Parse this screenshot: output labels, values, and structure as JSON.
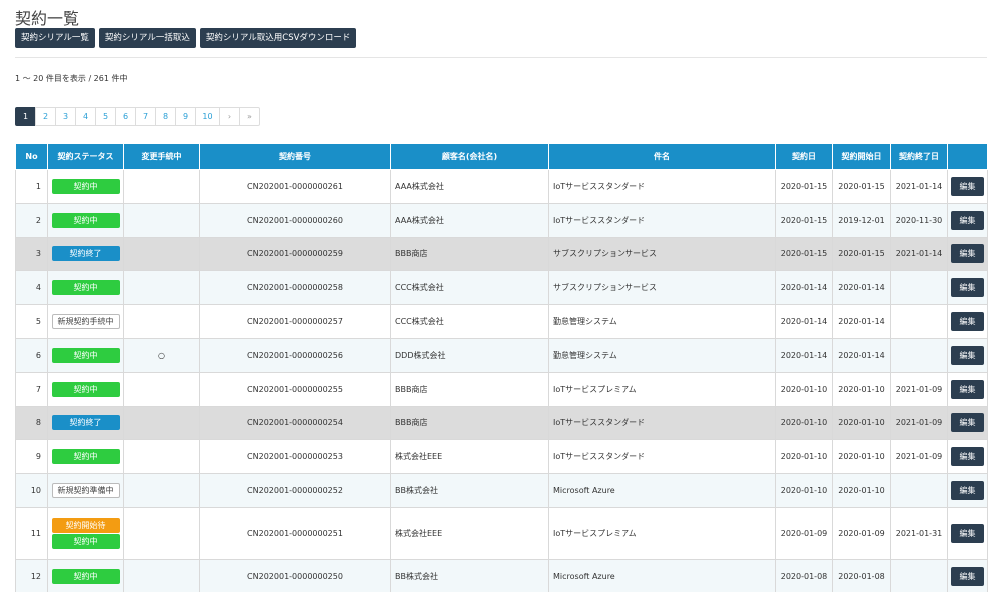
{
  "page": {
    "title": "契約一覧",
    "buttons": [
      "契約シリアル一覧",
      "契約シリアル一括取込",
      "契約シリアル取込用CSVダウンロード"
    ],
    "count_text": "1 ～ 20 件目を表示 / 261 件中"
  },
  "pagination": {
    "pages": [
      "1",
      "2",
      "3",
      "4",
      "5",
      "6",
      "7",
      "8",
      "9",
      "10"
    ],
    "next": "›",
    "last": "»",
    "active": "1"
  },
  "table": {
    "headers": {
      "no": "No",
      "status": "契約ステータス",
      "change": "変更手続中",
      "number": "契約番号",
      "customer": "顧客名(会社名)",
      "subject": "件名",
      "contract_date": "契約日",
      "start_date": "契約開始日",
      "end_date": "契約終了日",
      "edit": ""
    },
    "edit_label": "編集",
    "rows": [
      {
        "no": "1",
        "statuses": [
          {
            "label": "契約中",
            "kind": "active"
          }
        ],
        "change": "",
        "number": "CN202001-0000000261",
        "customer": "AAA株式会社",
        "subject": "IoTサービススタンダード",
        "contract_date": "2020-01-15",
        "start_date": "2020-01-15",
        "end_date": "2021-01-14"
      },
      {
        "no": "2",
        "statuses": [
          {
            "label": "契約中",
            "kind": "active"
          }
        ],
        "change": "",
        "number": "CN202001-0000000260",
        "customer": "AAA株式会社",
        "subject": "IoTサービススタンダード",
        "contract_date": "2020-01-15",
        "start_date": "2019-12-01",
        "end_date": "2020-11-30"
      },
      {
        "no": "3",
        "statuses": [
          {
            "label": "契約終了",
            "kind": "ended"
          }
        ],
        "change": "",
        "number": "CN202001-0000000259",
        "customer": "BBB商店",
        "subject": "サブスクリプションサービス",
        "contract_date": "2020-01-15",
        "start_date": "2020-01-15",
        "end_date": "2021-01-14"
      },
      {
        "no": "4",
        "statuses": [
          {
            "label": "契約中",
            "kind": "active"
          }
        ],
        "change": "",
        "number": "CN202001-0000000258",
        "customer": "CCC株式会社",
        "subject": "サブスクリプションサービス",
        "contract_date": "2020-01-14",
        "start_date": "2020-01-14",
        "end_date": ""
      },
      {
        "no": "5",
        "statuses": [
          {
            "label": "新規契約手続中",
            "kind": "new"
          }
        ],
        "change": "",
        "number": "CN202001-0000000257",
        "customer": "CCC株式会社",
        "subject": "勤怠管理システム",
        "contract_date": "2020-01-14",
        "start_date": "2020-01-14",
        "end_date": ""
      },
      {
        "no": "6",
        "statuses": [
          {
            "label": "契約中",
            "kind": "active"
          }
        ],
        "change": "○",
        "number": "CN202001-0000000256",
        "customer": "DDD株式会社",
        "subject": "勤怠管理システム",
        "contract_date": "2020-01-14",
        "start_date": "2020-01-14",
        "end_date": ""
      },
      {
        "no": "7",
        "statuses": [
          {
            "label": "契約中",
            "kind": "active"
          }
        ],
        "change": "",
        "number": "CN202001-0000000255",
        "customer": "BBB商店",
        "subject": "IoTサービスプレミアム",
        "contract_date": "2020-01-10",
        "start_date": "2020-01-10",
        "end_date": "2021-01-09"
      },
      {
        "no": "8",
        "statuses": [
          {
            "label": "契約終了",
            "kind": "ended"
          }
        ],
        "change": "",
        "number": "CN202001-0000000254",
        "customer": "BBB商店",
        "subject": "IoTサービススタンダード",
        "contract_date": "2020-01-10",
        "start_date": "2020-01-10",
        "end_date": "2021-01-09"
      },
      {
        "no": "9",
        "statuses": [
          {
            "label": "契約中",
            "kind": "active"
          }
        ],
        "change": "",
        "number": "CN202001-0000000253",
        "customer": "株式会社EEE",
        "subject": "IoTサービススタンダード",
        "contract_date": "2020-01-10",
        "start_date": "2020-01-10",
        "end_date": "2021-01-09"
      },
      {
        "no": "10",
        "statuses": [
          {
            "label": "新規契約準備中",
            "kind": "new"
          }
        ],
        "change": "",
        "number": "CN202001-0000000252",
        "customer": "BB株式会社",
        "subject": "Microsoft Azure",
        "contract_date": "2020-01-10",
        "start_date": "2020-01-10",
        "end_date": ""
      },
      {
        "no": "11",
        "statuses": [
          {
            "label": "契約開始待",
            "kind": "wait"
          },
          {
            "label": "契約中",
            "kind": "active"
          }
        ],
        "change": "",
        "number": "CN202001-0000000251",
        "customer": "株式会社EEE",
        "subject": "IoTサービスプレミアム",
        "contract_date": "2020-01-09",
        "start_date": "2020-01-09",
        "end_date": "2021-01-31"
      },
      {
        "no": "12",
        "statuses": [
          {
            "label": "契約中",
            "kind": "active"
          }
        ],
        "change": "",
        "number": "CN202001-0000000250",
        "customer": "BB株式会社",
        "subject": "Microsoft Azure",
        "contract_date": "2020-01-08",
        "start_date": "2020-01-08",
        "end_date": ""
      }
    ]
  },
  "colors": {
    "header_bg": "#1a8fc8",
    "button_bg": "#2c3e50",
    "status_active": "#2ecc40",
    "status_ended": "#1a8fc8",
    "status_wait": "#f39c12"
  }
}
